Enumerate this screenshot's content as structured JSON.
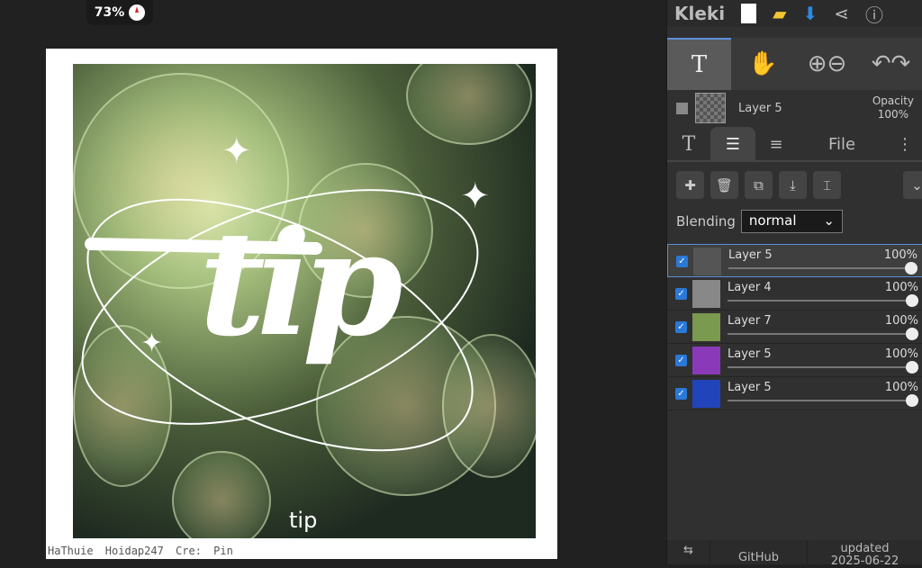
{
  "zoom": {
    "value": "73%"
  },
  "canvas": {
    "title_text": "tip",
    "caption": "tip",
    "credit": "HaThuie  Hoidap247  Cre: Pin"
  },
  "header": {
    "logo": "Kleki"
  },
  "current_layer": {
    "name": "Layer 5",
    "opacity_label": "Opacity",
    "opacity": "100%"
  },
  "tabs": {
    "file": "File"
  },
  "blending": {
    "label": "Blending",
    "value": "normal"
  },
  "layers": [
    {
      "name": "Layer 5",
      "opacity": "100%",
      "active": true,
      "color": "#555"
    },
    {
      "name": "Layer 4",
      "opacity": "100%",
      "active": false,
      "color": "#888"
    },
    {
      "name": "Layer 7",
      "opacity": "100%",
      "active": false,
      "color": "#7a9a50"
    },
    {
      "name": "Layer 5",
      "opacity": "100%",
      "active": false,
      "color": "#8a3ab8"
    },
    {
      "name": "Layer 5",
      "opacity": "100%",
      "active": false,
      "color": "#2244bb"
    }
  ],
  "footer": {
    "github": "GitHub",
    "updated": "updated",
    "date": "2025-06-22"
  }
}
